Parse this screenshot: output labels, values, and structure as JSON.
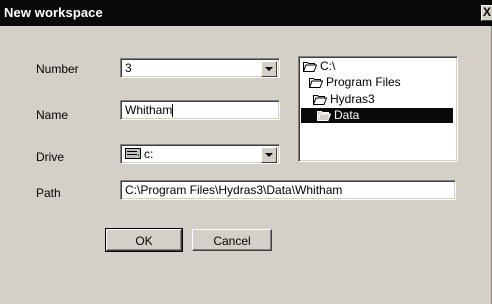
{
  "window": {
    "title": "New workspace",
    "close_glyph": "X"
  },
  "form": {
    "number_label": "Number",
    "number_value": "3",
    "name_label": "Name",
    "name_value": "Whitham",
    "drive_label": "Drive",
    "drive_value": "c:",
    "path_label": "Path",
    "path_value": "C:\\Program Files\\Hydras3\\Data\\Whitham"
  },
  "tree": {
    "items": [
      {
        "label": "C:\\",
        "icon": "folder-open-icon"
      },
      {
        "label": "Program Files",
        "icon": "folder-open-icon"
      },
      {
        "label": "Hydras3",
        "icon": "folder-open-icon"
      },
      {
        "label": "Data",
        "icon": "folder-open-icon",
        "selected": true
      }
    ]
  },
  "buttons": {
    "ok": "OK",
    "cancel": "Cancel"
  },
  "colors": {
    "titlebar": "#0a0a0a",
    "face": "#d4d0c8",
    "selection": "#0a0a0a"
  }
}
